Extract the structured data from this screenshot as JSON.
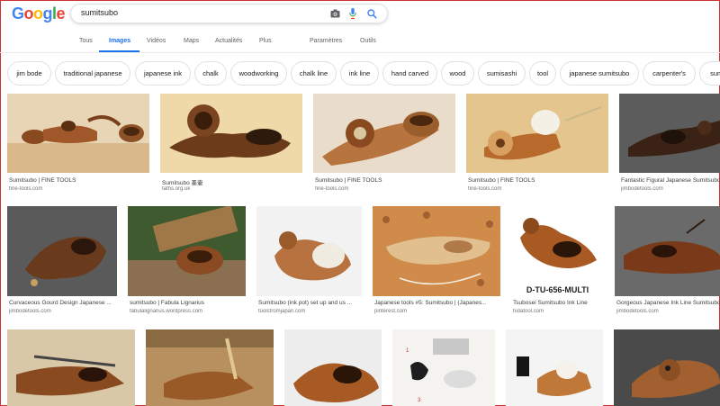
{
  "brand": {
    "logo_letters": [
      "G",
      "o",
      "o",
      "g",
      "l",
      "e"
    ],
    "logo_colors": [
      "#4285F4",
      "#EA4335",
      "#FBBC05",
      "#4285F4",
      "#34A853",
      "#EA4335"
    ]
  },
  "search": {
    "query": "sumitsubo"
  },
  "tabs": [
    {
      "label": "Tous"
    },
    {
      "label": "Images"
    },
    {
      "label": "Vidéos"
    },
    {
      "label": "Maps"
    },
    {
      "label": "Actualités"
    },
    {
      "label": "Plus"
    },
    {
      "label": "Paramètres"
    },
    {
      "label": "Outils"
    }
  ],
  "chips": [
    "jim bode",
    "traditional japanese",
    "japanese ink",
    "chalk",
    "woodworking",
    "chalk line",
    "ink line",
    "hand carved",
    "wood",
    "sumisashi",
    "tool",
    "japanese sumitsubo",
    "carpenter's",
    "sumi"
  ],
  "results": [
    {
      "title": "Sumitsubo | FINE TOOLS",
      "site": "fine-tools.com"
    },
    {
      "title": "Sumitsubo 墨壷",
      "site": "taths.org.uk"
    },
    {
      "title": "Sumitsubo | FINE TOOLS",
      "site": "fine-tools.com"
    },
    {
      "title": "Sumitsubo | FINE TOOLS",
      "site": "fine-tools.com"
    },
    {
      "title": "Fantastic Figural Japanese Sumitsubo",
      "site": "jimbodetools.com"
    },
    {
      "title": "Curvaceous Gourd Design Japanese ...",
      "site": "jimbodetools.com"
    },
    {
      "title": "sumitsubo | Fabula Lignarius",
      "site": "fabulalignarius.wordpress.com"
    },
    {
      "title": "Sumitsubo (ink pot) set up and us ...",
      "site": "toolsfromjapan.com"
    },
    {
      "title": "Japanese tools #5: Sumitsubo | (Japanes...",
      "site": "pinterest.com"
    },
    {
      "title": "Tsubosei Sumitsubo Ink Line",
      "site": "hidatool.com",
      "overlay": "D-TU-656-MULTI"
    },
    {
      "title": "Gorgeous Japanese Ink Line Sumitsubo",
      "site": "jimbodetools.com"
    },
    {
      "title": "",
      "site": ""
    },
    {
      "title": "",
      "site": ""
    },
    {
      "title": "",
      "site": ""
    },
    {
      "title": "",
      "site": ""
    },
    {
      "title": "",
      "site": ""
    },
    {
      "title": "",
      "site": ""
    }
  ],
  "colors": {
    "accent": "#1a73e8",
    "wood_light": "#d9a46a",
    "wood_dark": "#7a3f1c"
  }
}
